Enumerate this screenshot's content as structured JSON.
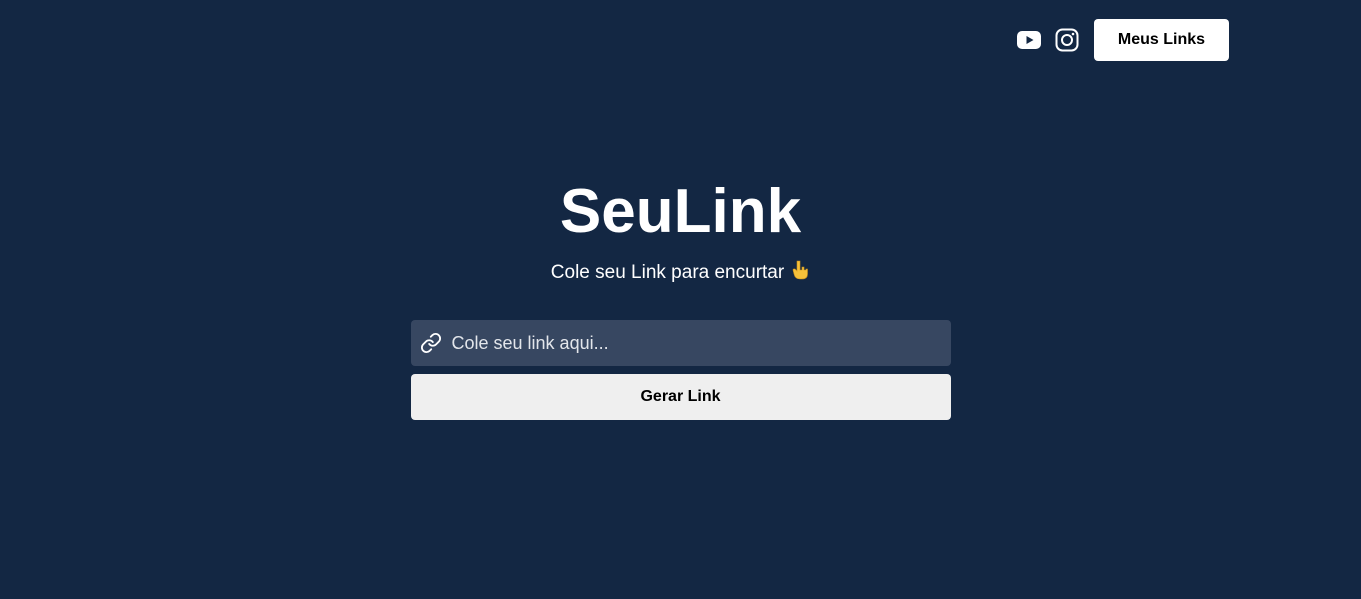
{
  "header": {
    "icons": [
      "youtube-icon",
      "instagram-icon"
    ],
    "meus_links_label": "Meus Links"
  },
  "main": {
    "title": "SeuLink",
    "subtitle": "Cole seu Link para encurtar",
    "subtitle_icon": "pointing-down-hand-icon",
    "input_placeholder": "Cole seu link aqui...",
    "input_value": "",
    "input_icon": "link-icon",
    "gerar_label": "Gerar Link"
  },
  "colors": {
    "background": "#132743",
    "input_background": "#374761",
    "button_light": "#efefef",
    "accent_emoji": "#f6c13a"
  }
}
